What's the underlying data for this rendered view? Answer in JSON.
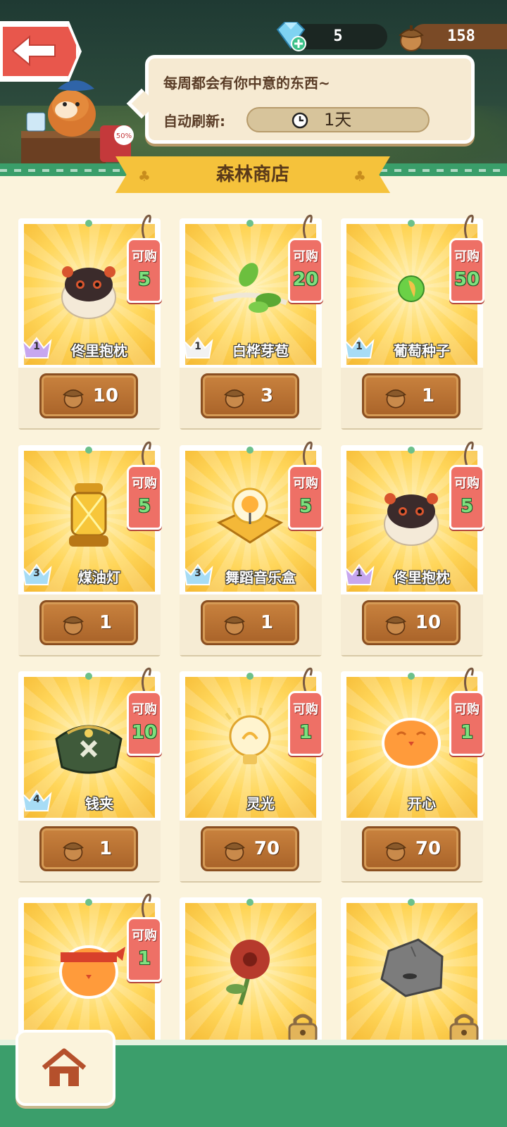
{
  "topbar": {
    "gems": "5",
    "acorns": "158"
  },
  "bubble": {
    "message": "每周都会有你中意的东西~",
    "refresh_label": "自动刷新:",
    "refresh_value": "1天"
  },
  "shop": {
    "title": "森林商店",
    "tag_label": "可购",
    "items": [
      {
        "name": "佟里抱枕",
        "level": "1",
        "limit": "5",
        "price": "10",
        "art": "seal-pillow-icon",
        "level_color": "#c7a7ef"
      },
      {
        "name": "白桦芽苞",
        "level": "1",
        "limit": "20",
        "price": "3",
        "art": "birch-sprout-icon",
        "level_color": "#f2f2f2"
      },
      {
        "name": "葡萄种子",
        "level": "1",
        "limit": "50",
        "price": "1",
        "art": "grape-seed-icon",
        "level_color": "#a7dcf5"
      },
      {
        "name": "煤油灯",
        "level": "3",
        "limit": "5",
        "price": "1",
        "art": "lantern-icon",
        "level_color": "#a7dcf5"
      },
      {
        "name": "舞蹈音乐盒",
        "level": "3",
        "limit": "5",
        "price": "1",
        "art": "music-box-icon",
        "level_color": "#a7dcf5"
      },
      {
        "name": "佟里抱枕",
        "level": "1",
        "limit": "5",
        "price": "10",
        "art": "seal-pillow-icon",
        "level_color": "#c7a7ef"
      },
      {
        "name": "钱夹",
        "level": "4",
        "limit": "10",
        "price": "1",
        "art": "purse-icon",
        "level_color": "#a7dcf5"
      },
      {
        "name": "灵光",
        "level": "",
        "limit": "1",
        "price": "70",
        "art": "lightbulb-icon",
        "level_color": ""
      },
      {
        "name": "开心",
        "level": "",
        "limit": "1",
        "price": "70",
        "art": "happy-face-icon",
        "level_color": ""
      },
      {
        "name": "",
        "level": "",
        "limit": "1",
        "price": "",
        "art": "headband-face-icon",
        "level_color": ""
      },
      {
        "name": "",
        "level": "",
        "limit": "",
        "price": "",
        "art": "red-flower-icon",
        "level_color": ""
      },
      {
        "name": "",
        "level": "",
        "limit": "",
        "price": "",
        "art": "rock-icon",
        "level_color": ""
      }
    ]
  }
}
